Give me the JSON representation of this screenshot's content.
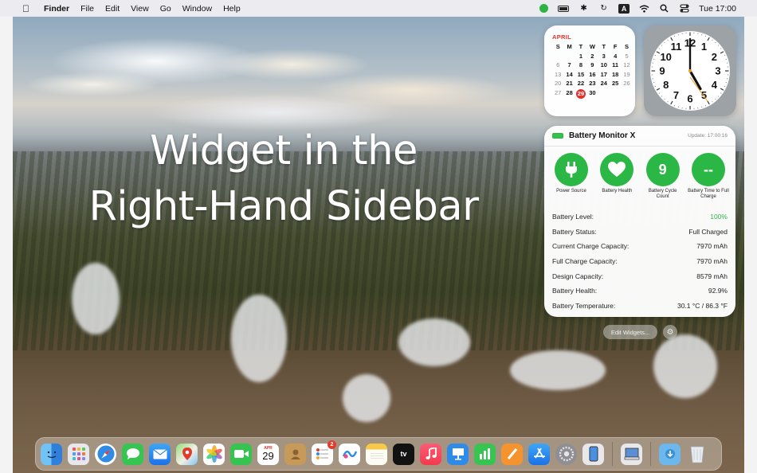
{
  "menubar": {
    "app_name": "Finder",
    "menus": [
      "File",
      "Edit",
      "View",
      "Go",
      "Window",
      "Help"
    ],
    "clock": "Tue 17:00"
  },
  "overlay": {
    "line1": "Widget in the",
    "line2": "Right-Hand Sidebar"
  },
  "calendar": {
    "month": "APRIL",
    "weekdays": [
      "S",
      "M",
      "T",
      "W",
      "T",
      "F",
      "S"
    ],
    "days": [
      "",
      "",
      "1",
      "2",
      "3",
      "4",
      "5",
      "6",
      "7",
      "8",
      "9",
      "10",
      "11",
      "12",
      "13",
      "14",
      "15",
      "16",
      "17",
      "18",
      "19",
      "20",
      "21",
      "22",
      "23",
      "24",
      "25",
      "26",
      "27",
      "28",
      "29",
      "30",
      "",
      "",
      ""
    ],
    "today": "29"
  },
  "clock_widget": {
    "numbers": [
      "12",
      "1",
      "2",
      "3",
      "4",
      "5",
      "6",
      "7",
      "8",
      "9",
      "10",
      "11"
    ],
    "hour": 17,
    "minute": 0
  },
  "battery_widget": {
    "title": "Battery Monitor X",
    "update": "Update: 17:00:16",
    "circles": [
      {
        "symbol": "plug-icon",
        "value": "",
        "label": "Power Source"
      },
      {
        "symbol": "heart-icon",
        "value": "",
        "label": "Battery Health"
      },
      {
        "symbol": "",
        "value": "9",
        "label": "Battery Cycle Count"
      },
      {
        "symbol": "",
        "value": "--",
        "label": "Battery Time to Full Charge"
      }
    ],
    "rows": [
      {
        "label": "Battery Level:",
        "value": "100%",
        "green": true
      },
      {
        "label": "Battery Status:",
        "value": "Full Charged",
        "green": false
      },
      {
        "label": "Current Charge Capacity:",
        "value": "7970 mAh",
        "green": false
      },
      {
        "label": "Full Charge Capacity:",
        "value": "7970 mAh",
        "green": false
      },
      {
        "label": "Design Capacity:",
        "value": "8579 mAh",
        "green": false
      },
      {
        "label": "Battery Health:",
        "value": "92.9%",
        "green": false
      },
      {
        "label": "Battery Temperature:",
        "value": "30.1 °C / 86.3 °F",
        "green": false
      }
    ],
    "accent": "#2bb745"
  },
  "edit_widgets": "Edit Widgets...",
  "dock": {
    "calendar_month": "APR",
    "calendar_day": "29",
    "reminders_badge": "2",
    "apple_tv_label": "tv"
  }
}
